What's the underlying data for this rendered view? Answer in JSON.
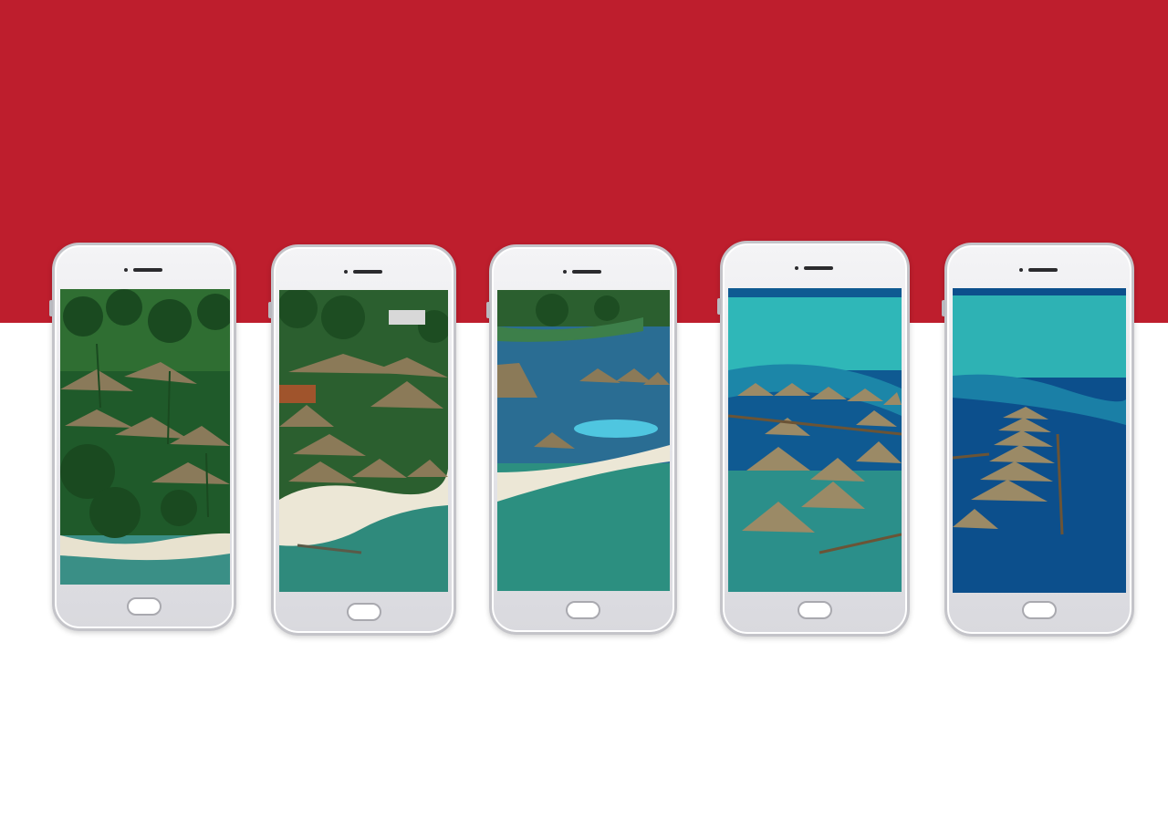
{
  "colors": {
    "band": "#be1e2d",
    "background": "#ffffff",
    "phone_frame": "#e6e6ea"
  },
  "phones": [
    {
      "scene": "palm-grove-bungalows-photo"
    },
    {
      "scene": "beach-bungalows-photo"
    },
    {
      "scene": "pool-lagoon-photo"
    },
    {
      "scene": "overwater-bungalows-photo"
    },
    {
      "scene": "overwater-bungalows-pier-photo"
    }
  ]
}
